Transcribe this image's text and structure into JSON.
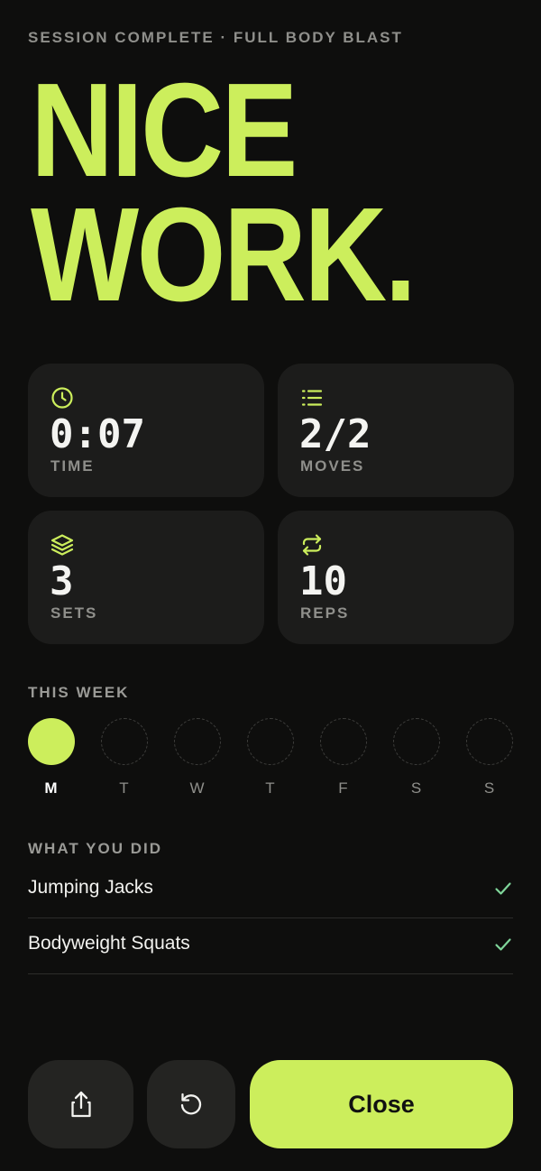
{
  "header": {
    "eyebrow": "SESSION COMPLETE · FULL BODY BLAST",
    "hero_line1": "NICE",
    "hero_line2": "WORK."
  },
  "stats": [
    {
      "icon": "clock-icon",
      "value": "0:07",
      "label": "TIME"
    },
    {
      "icon": "list-icon",
      "value": "2/2",
      "label": "MOVES"
    },
    {
      "icon": "layers-icon",
      "value": "3",
      "label": "SETS"
    },
    {
      "icon": "repeat-icon",
      "value": "10",
      "label": "REPS"
    }
  ],
  "week": {
    "title": "THIS WEEK",
    "days": [
      {
        "letter": "M",
        "done": true
      },
      {
        "letter": "T",
        "done": false
      },
      {
        "letter": "W",
        "done": false
      },
      {
        "letter": "T",
        "done": false
      },
      {
        "letter": "F",
        "done": false
      },
      {
        "letter": "S",
        "done": false
      },
      {
        "letter": "S",
        "done": false
      }
    ]
  },
  "completed": {
    "title": "WHAT YOU DID",
    "items": [
      {
        "name": "Jumping Jacks",
        "done": true
      },
      {
        "name": "Bodyweight Squats",
        "done": true
      }
    ]
  },
  "actions": {
    "share_icon": "share-icon",
    "restart_icon": "restart-icon",
    "close_label": "Close"
  },
  "colors": {
    "background": "#0e0e0d",
    "accent": "#ccee5c",
    "card": "#1c1c1b",
    "check": "#7fd59a"
  }
}
